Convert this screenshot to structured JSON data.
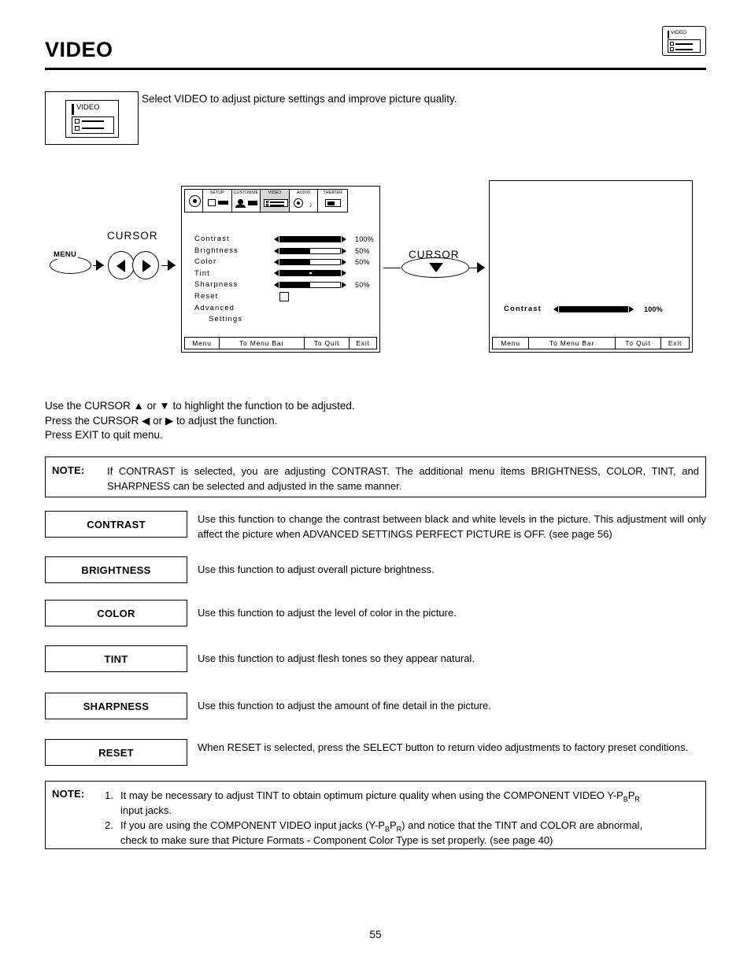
{
  "header": {
    "title": "VIDEO",
    "icon_label": "VIDEO"
  },
  "intro": {
    "text": "Select VIDEO to adjust picture settings and improve picture quality.",
    "icon_label": "VIDEO"
  },
  "osd_left": {
    "menubar": [
      {
        "label": "SETUP",
        "icon": "tools-icon"
      },
      {
        "label": "CUSTOMIZE",
        "icon": "person-icon"
      },
      {
        "label": "VIDEO",
        "icon": "sliders-icon"
      },
      {
        "label": "AUDIO",
        "icon": "speaker-icon"
      },
      {
        "label": "THEATER",
        "icon": "screen-icon"
      }
    ],
    "selected_tab": "VIDEO",
    "items": [
      {
        "label": "Contrast",
        "value": "100%",
        "fill": 100,
        "type": "bar"
      },
      {
        "label": "Brightness",
        "value": "50%",
        "fill": 50,
        "type": "bar"
      },
      {
        "label": "Color",
        "value": "50%",
        "fill": 50,
        "type": "bar"
      },
      {
        "label": "Tint",
        "value": "",
        "fill": 50,
        "type": "knob"
      },
      {
        "label": "Sharpness",
        "value": "50%",
        "fill": 50,
        "type": "bar"
      },
      {
        "label": "Reset",
        "value": "",
        "type": "checkbox"
      },
      {
        "label": "Advanced",
        "value": "",
        "type": "text"
      },
      {
        "label": "Settings",
        "value": "",
        "type": "text-indent"
      }
    ],
    "footer": [
      "Menu",
      "To Menu Bar",
      "To Quit",
      "Exit"
    ]
  },
  "osd_right": {
    "contrast_label": "Contrast",
    "contrast_value": "100%",
    "footer": [
      "Menu",
      "To Menu Bar",
      "To Quit",
      "Exit"
    ]
  },
  "diagram": {
    "menu_button": "MENU",
    "cursor_label_left": "CURSOR",
    "cursor_label_right": "CURSOR"
  },
  "instructions": [
    "Use the CURSOR ▲ or ▼ to highlight the function to be adjusted.",
    "Press the CURSOR ◀ or ▶ to adjust the function.",
    "Press EXIT to quit menu."
  ],
  "note_top": {
    "label": "NOTE:",
    "text": "If CONTRAST is selected, you are adjusting CONTRAST.  The additional menu items BRIGHTNESS, COLOR, TINT, and SHARPNESS can be selected and adjusted in the same manner."
  },
  "functions": [
    {
      "name": "CONTRAST",
      "desc": "Use this function to change the contrast between black and white levels in the picture.  This adjustment will only affect the picture when ADVANCED SETTINGS PERFECT PICTURE is OFF. (see page 56)"
    },
    {
      "name": "BRIGHTNESS",
      "desc": "Use this function to adjust overall picture brightness."
    },
    {
      "name": "COLOR",
      "desc": "Use this function to adjust the level of color in the picture."
    },
    {
      "name": "TINT",
      "desc": "Use this function to adjust flesh tones so they appear natural."
    },
    {
      "name": "SHARPNESS",
      "desc": "Use this function to adjust the amount of fine detail in the picture."
    },
    {
      "name": "RESET",
      "desc": "When RESET is selected, press the SELECT button to return video adjustments to factory preset conditions."
    }
  ],
  "note_bottom": {
    "label": "NOTE:",
    "item1_num": "1.",
    "item1_part1": "It may be necessary to adjust TINT to obtain optimum picture quality when using the COMPONENT VIDEO Y-P",
    "item1_sub1": "B",
    "item1_part2": "P",
    "item1_sub2": "R",
    "item1_line2": "input jacks.",
    "item2_num": "2.",
    "item2_part1": "If you are using the COMPONENT VIDEO input jacks (Y-P",
    "item2_sub1": "B",
    "item2_part2": "P",
    "item2_sub2": "R",
    "item2_part3": ") and notice that the TINT and COLOR are abnormal,",
    "item2_line2": "check to make sure that Picture Formats - Component Color Type is set properly. (see page 40)"
  },
  "page_number": "55"
}
